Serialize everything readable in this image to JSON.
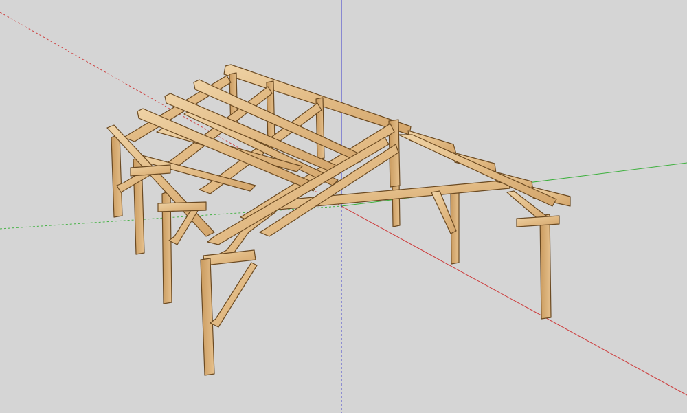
{
  "viewport": {
    "background": "#d5d5d5",
    "axis_colors": {
      "red": "#cc2222",
      "green": "#22aa22",
      "blue": "#2222cc"
    }
  },
  "model": {
    "kind": "timber-frame-shed",
    "wood_colors": {
      "light": "#e9c89a",
      "mid": "#d9ad72",
      "dark": "#b98a50",
      "edge": "#6b4a22"
    }
  }
}
